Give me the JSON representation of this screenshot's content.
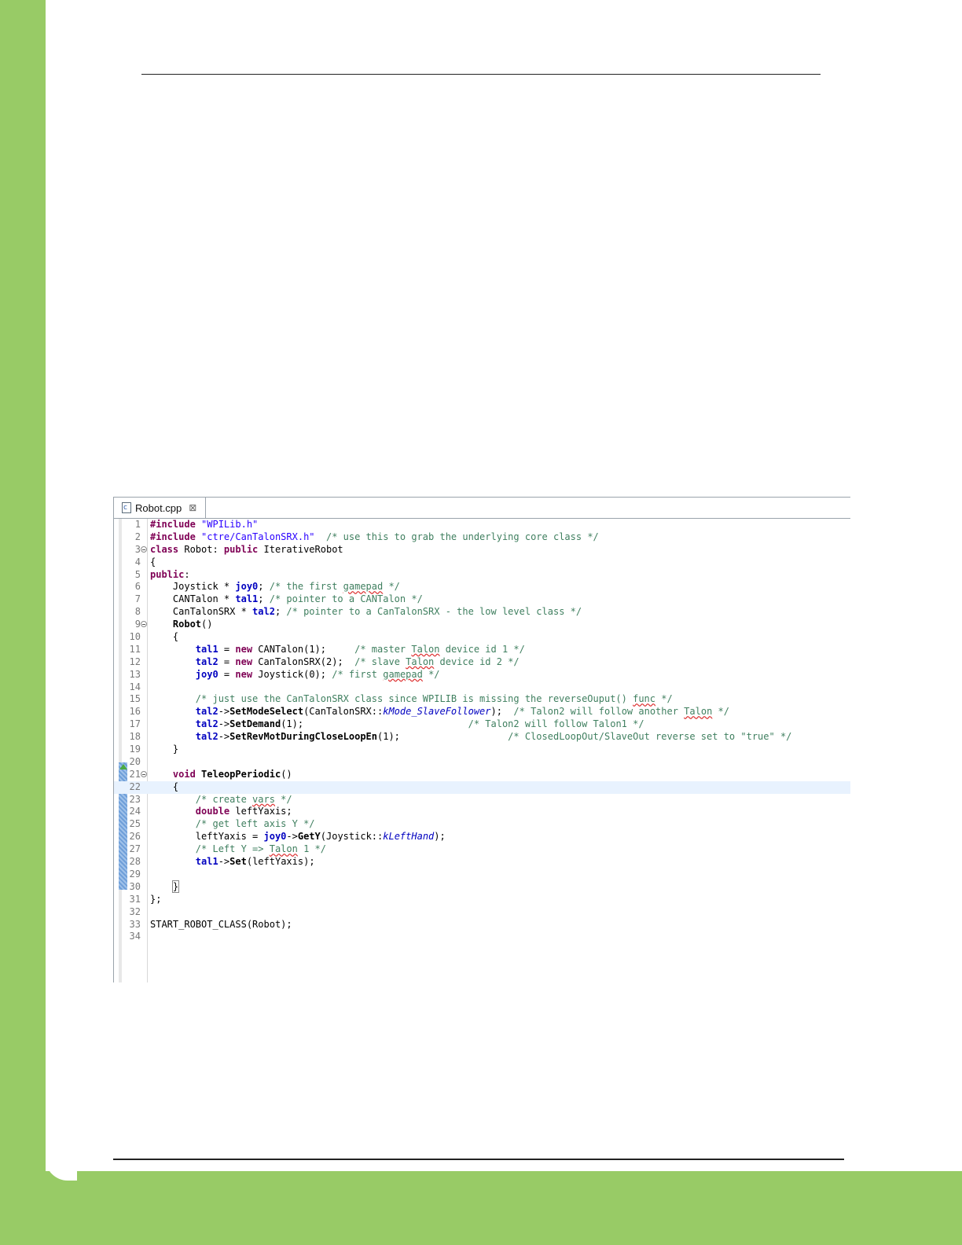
{
  "editor": {
    "tab_label": "Robot.cpp",
    "file_icon_letter": "c",
    "close_glyph": "⊠"
  },
  "code_lines": [
    {
      "n": "1",
      "tokens": [
        {
          "t": "#include",
          "c": "kw"
        },
        {
          "t": " "
        },
        {
          "t": "\"WPILib.h\"",
          "c": "str"
        }
      ]
    },
    {
      "n": "2",
      "tokens": [
        {
          "t": "#include",
          "c": "kw"
        },
        {
          "t": " "
        },
        {
          "t": "\"ctre/CanTalonSRX.h\"",
          "c": "str"
        },
        {
          "t": "  "
        },
        {
          "t": "/* use this to grab the underlying core class */",
          "c": "cm"
        }
      ]
    },
    {
      "n": "3",
      "fold": true,
      "tokens": [
        {
          "t": "class",
          "c": "kw"
        },
        {
          "t": " Robot: "
        },
        {
          "t": "public",
          "c": "kw"
        },
        {
          "t": " IterativeRobot"
        }
      ]
    },
    {
      "n": "4",
      "tokens": [
        {
          "t": "{"
        }
      ]
    },
    {
      "n": "5",
      "tokens": [
        {
          "t": "public",
          "c": "kw"
        },
        {
          "t": ":"
        }
      ]
    },
    {
      "n": "6",
      "tokens": [
        {
          "t": "    Joystick * "
        },
        {
          "t": "joy0",
          "c": "fld"
        },
        {
          "t": "; "
        },
        {
          "t": "/* the first ",
          "c": "cm"
        },
        {
          "t": "gamepad",
          "c": "cm sp"
        },
        {
          "t": " */",
          "c": "cm"
        }
      ]
    },
    {
      "n": "7",
      "tokens": [
        {
          "t": "    CANTalon * "
        },
        {
          "t": "tal1",
          "c": "fld"
        },
        {
          "t": "; "
        },
        {
          "t": "/* pointer to a CANTalon */",
          "c": "cm"
        }
      ]
    },
    {
      "n": "8",
      "tokens": [
        {
          "t": "    CanTalonSRX * "
        },
        {
          "t": "tal2",
          "c": "fld"
        },
        {
          "t": "; "
        },
        {
          "t": "/* pointer to a CanTalonSRX - the low level class */",
          "c": "cm"
        }
      ]
    },
    {
      "n": "9",
      "fold": true,
      "tokens": [
        {
          "t": "    "
        },
        {
          "t": "Robot",
          "c": "fn"
        },
        {
          "t": "()"
        }
      ]
    },
    {
      "n": "10",
      "tokens": [
        {
          "t": "    {"
        }
      ]
    },
    {
      "n": "11",
      "tokens": [
        {
          "t": "        "
        },
        {
          "t": "tal1",
          "c": "fld"
        },
        {
          "t": " = "
        },
        {
          "t": "new",
          "c": "kw"
        },
        {
          "t": " CANTalon(1);     "
        },
        {
          "t": "/* master ",
          "c": "cm"
        },
        {
          "t": "Talon",
          "c": "cm sp"
        },
        {
          "t": " device id 1 */",
          "c": "cm"
        }
      ]
    },
    {
      "n": "12",
      "tokens": [
        {
          "t": "        "
        },
        {
          "t": "tal2",
          "c": "fld"
        },
        {
          "t": " = "
        },
        {
          "t": "new",
          "c": "kw"
        },
        {
          "t": " CanTalonSRX(2);  "
        },
        {
          "t": "/* slave ",
          "c": "cm"
        },
        {
          "t": "Talon",
          "c": "cm sp"
        },
        {
          "t": " device id 2 */",
          "c": "cm"
        }
      ]
    },
    {
      "n": "13",
      "tokens": [
        {
          "t": "        "
        },
        {
          "t": "joy0",
          "c": "fld"
        },
        {
          "t": " = "
        },
        {
          "t": "new",
          "c": "kw"
        },
        {
          "t": " Joystick(0); "
        },
        {
          "t": "/* first ",
          "c": "cm"
        },
        {
          "t": "gamepad",
          "c": "cm sp"
        },
        {
          "t": " */",
          "c": "cm"
        }
      ]
    },
    {
      "n": "14",
      "tokens": []
    },
    {
      "n": "15",
      "tokens": [
        {
          "t": "        "
        },
        {
          "t": "/* just use the CanTalonSRX class since WPILIB is missing the reverseOuput() ",
          "c": "cm"
        },
        {
          "t": "func",
          "c": "cm sp"
        },
        {
          "t": " */",
          "c": "cm"
        }
      ]
    },
    {
      "n": "16",
      "tokens": [
        {
          "t": "        "
        },
        {
          "t": "tal2",
          "c": "fld"
        },
        {
          "t": "->"
        },
        {
          "t": "SetModeSelect",
          "c": "fn"
        },
        {
          "t": "(CanTalonSRX::"
        },
        {
          "t": "kMode_SlaveFollower",
          "c": "en"
        },
        {
          "t": ");  "
        },
        {
          "t": "/* Talon2 will follow another ",
          "c": "cm"
        },
        {
          "t": "Talon",
          "c": "cm sp"
        },
        {
          "t": " */",
          "c": "cm"
        }
      ]
    },
    {
      "n": "17",
      "tokens": [
        {
          "t": "        "
        },
        {
          "t": "tal2",
          "c": "fld"
        },
        {
          "t": "->"
        },
        {
          "t": "SetDemand",
          "c": "fn"
        },
        {
          "t": "(1);                             "
        },
        {
          "t": "/* Talon2 will follow Talon1 */",
          "c": "cm"
        }
      ]
    },
    {
      "n": "18",
      "tokens": [
        {
          "t": "        "
        },
        {
          "t": "tal2",
          "c": "fld"
        },
        {
          "t": "->"
        },
        {
          "t": "SetRevMotDuringCloseLoopEn",
          "c": "fn"
        },
        {
          "t": "(1);                   "
        },
        {
          "t": "/* ClosedLoopOut/SlaveOut reverse set to \"true\" */",
          "c": "cm"
        }
      ]
    },
    {
      "n": "19",
      "tokens": [
        {
          "t": "    }"
        }
      ]
    },
    {
      "n": "20",
      "tokens": []
    },
    {
      "n": "21",
      "fold": true,
      "tokens": [
        {
          "t": "    "
        },
        {
          "t": "void",
          "c": "kw"
        },
        {
          "t": " "
        },
        {
          "t": "TeleopPeriodic",
          "c": "fn"
        },
        {
          "t": "()"
        }
      ]
    },
    {
      "n": "22",
      "current": true,
      "tokens": [
        {
          "t": "    {"
        }
      ]
    },
    {
      "n": "23",
      "tokens": [
        {
          "t": "        "
        },
        {
          "t": "/* create ",
          "c": "cm"
        },
        {
          "t": "vars",
          "c": "cm sp"
        },
        {
          "t": " */",
          "c": "cm"
        }
      ]
    },
    {
      "n": "24",
      "tokens": [
        {
          "t": "        "
        },
        {
          "t": "double",
          "c": "kw"
        },
        {
          "t": " leftYaxis;"
        }
      ]
    },
    {
      "n": "25",
      "tokens": [
        {
          "t": "        "
        },
        {
          "t": "/* get left axis Y */",
          "c": "cm"
        }
      ]
    },
    {
      "n": "26",
      "tokens": [
        {
          "t": "        leftYaxis = "
        },
        {
          "t": "joy0",
          "c": "fld"
        },
        {
          "t": "->"
        },
        {
          "t": "GetY",
          "c": "fn"
        },
        {
          "t": "(Joystick::"
        },
        {
          "t": "kLeftHand",
          "c": "en"
        },
        {
          "t": ");"
        }
      ]
    },
    {
      "n": "27",
      "tokens": [
        {
          "t": "        "
        },
        {
          "t": "/* Left Y => ",
          "c": "cm"
        },
        {
          "t": "Talon",
          "c": "cm sp"
        },
        {
          "t": " 1 */",
          "c": "cm"
        }
      ]
    },
    {
      "n": "28",
      "tokens": [
        {
          "t": "        "
        },
        {
          "t": "tal1",
          "c": "fld"
        },
        {
          "t": "->"
        },
        {
          "t": "Set",
          "c": "fn"
        },
        {
          "t": "(leftYaxis);"
        }
      ]
    },
    {
      "n": "29",
      "tokens": []
    },
    {
      "n": "30",
      "tokens": [
        {
          "t": "    "
        },
        {
          "t": "}",
          "c": "brace-box"
        }
      ]
    },
    {
      "n": "31",
      "tokens": [
        {
          "t": "};"
        }
      ]
    },
    {
      "n": "32",
      "tokens": []
    },
    {
      "n": "33",
      "tokens": [
        {
          "t": "START_ROBOT_CLASS(Robot);"
        }
      ]
    },
    {
      "n": "34",
      "tokens": []
    }
  ]
}
